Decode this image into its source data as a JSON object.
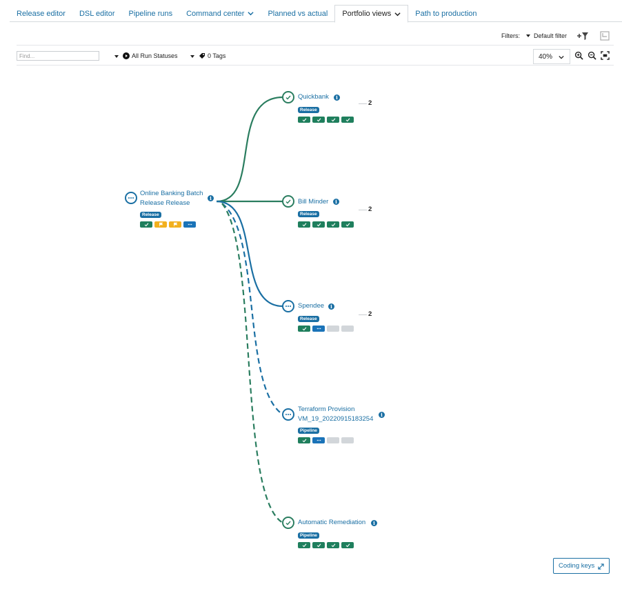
{
  "tabs": [
    {
      "label": "Release editor"
    },
    {
      "label": "DSL editor"
    },
    {
      "label": "Pipeline runs"
    },
    {
      "label": "Command center"
    },
    {
      "label": "Planned vs actual"
    },
    {
      "label": "Portfolio views"
    },
    {
      "label": "Path to production"
    }
  ],
  "active_tab": "Portfolio views",
  "filters": {
    "label": "Filters:",
    "selected": "Default filter"
  },
  "toolbar": {
    "find_placeholder": "Find...",
    "run_status": "All Run Statuses",
    "tags": "0 Tags",
    "zoom": "40%"
  },
  "graph": {
    "root": {
      "title_line1": "Online Banking Batch",
      "title_line2": "Release Release",
      "badge": "Release",
      "status": "running",
      "stages": [
        "success",
        "warning",
        "warning",
        "running"
      ]
    },
    "children": [
      {
        "title_line1": "Quickbank",
        "title_line2": "",
        "badge": "Release",
        "status": "success",
        "count": "2",
        "link": "solid",
        "stages": [
          "success",
          "success",
          "success",
          "success"
        ]
      },
      {
        "title_line1": "Bill Minder",
        "title_line2": "",
        "badge": "Release",
        "status": "success",
        "count": "2",
        "link": "solid",
        "stages": [
          "success",
          "success",
          "success",
          "success"
        ]
      },
      {
        "title_line1": "Spendee",
        "title_line2": "",
        "badge": "Release",
        "status": "running",
        "count": "2",
        "link": "solid",
        "stages": [
          "success",
          "running",
          "pending",
          "pending"
        ]
      },
      {
        "title_line1": "Terraform Provision",
        "title_line2": "VM_19_20220915183254",
        "badge": "Pipeline",
        "status": "running",
        "count": "",
        "link": "dashed",
        "stages": [
          "success",
          "running",
          "pending",
          "pending"
        ]
      },
      {
        "title_line1": "Automatic Remediation",
        "title_line2": "",
        "badge": "Pipeline",
        "status": "success",
        "count": "",
        "link": "dashed",
        "stages": [
          "success",
          "success",
          "success",
          "success"
        ]
      }
    ]
  },
  "coding_keys_label": "Coding keys",
  "colors": {
    "link": "#1a6fa3",
    "success": "#2a7d5f",
    "warning": "#f2b01e",
    "pending": "#d2d6da"
  }
}
